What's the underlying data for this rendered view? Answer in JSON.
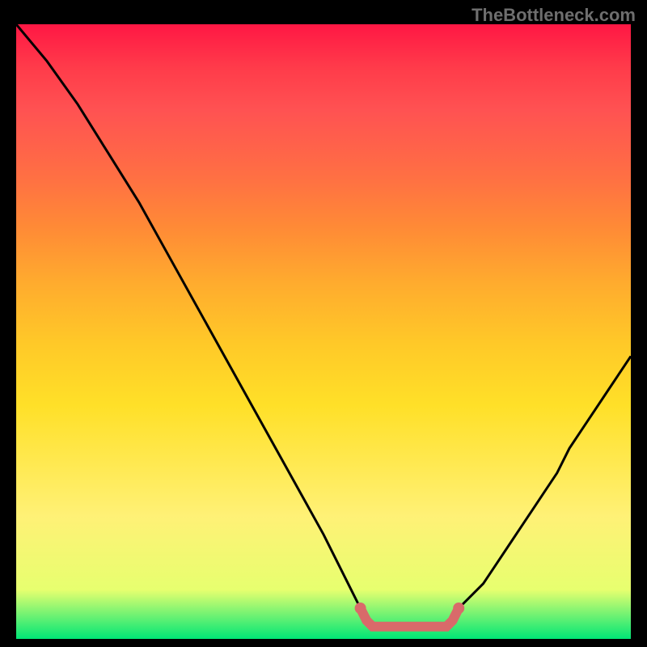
{
  "watermark": "TheBottleneck.com",
  "chart_data": {
    "type": "line",
    "title": "",
    "xlabel": "",
    "ylabel": "",
    "xlim": [
      0,
      100
    ],
    "ylim": [
      0,
      100
    ],
    "series": [
      {
        "name": "curve-left",
        "x": [
          0,
          5,
          10,
          15,
          20,
          25,
          30,
          35,
          40,
          45,
          50,
          52,
          54,
          56
        ],
        "y": [
          100,
          94,
          87,
          79,
          71,
          62,
          53,
          44,
          35,
          26,
          17,
          13,
          9,
          5
        ]
      },
      {
        "name": "curve-right",
        "x": [
          72,
          74,
          76,
          78,
          80,
          82,
          84,
          86,
          88,
          90,
          92,
          94,
          96,
          98,
          100
        ],
        "y": [
          5,
          7,
          9,
          12,
          15,
          18,
          21,
          24,
          27,
          31,
          34,
          37,
          40,
          43,
          46
        ]
      },
      {
        "name": "bottom-bracket",
        "x": [
          56,
          57,
          58,
          59,
          60,
          61,
          62,
          63,
          64,
          65,
          66,
          67,
          68,
          69,
          70,
          71,
          72
        ],
        "y": [
          5,
          3,
          2,
          2,
          2,
          2,
          2,
          2,
          2,
          2,
          2,
          2,
          2,
          2,
          2,
          3,
          5
        ],
        "style": "thick-rose"
      }
    ],
    "colors": {
      "curve": "#000000",
      "bracket": "#d96a6a",
      "gradient_top": "#ff1744",
      "gradient_bottom": "#00e676"
    }
  }
}
